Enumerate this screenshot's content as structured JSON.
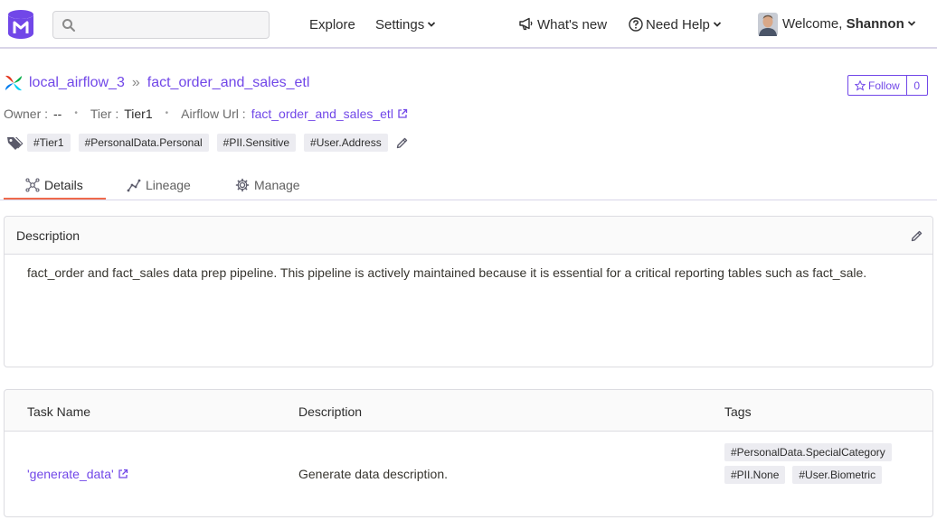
{
  "nav": {
    "search_placeholder": "",
    "explore": "Explore",
    "settings": "Settings",
    "whats_new": "What's new",
    "need_help": "Need Help",
    "welcome_prefix": "Welcome, ",
    "user_name": "Shannon"
  },
  "header": {
    "service": "local_airflow_3",
    "separator": "»",
    "pipeline": "fact_order_and_sales_etl",
    "follow_label": "Follow",
    "follow_count": "0"
  },
  "meta": {
    "owner_label": "Owner :",
    "owner_value": "--",
    "tier_label": "Tier :",
    "tier_value": "Tier1",
    "url_label": "Airflow Url :",
    "url_value": "fact_order_and_sales_etl",
    "dot": "•"
  },
  "tags": [
    "#Tier1",
    "#PersonalData.Personal",
    "#PII.Sensitive",
    "#User.Address"
  ],
  "tabs": [
    {
      "label": "Details",
      "icon": "details-icon"
    },
    {
      "label": "Lineage",
      "icon": "lineage-icon"
    },
    {
      "label": "Manage",
      "icon": "manage-icon"
    }
  ],
  "description": {
    "title": "Description",
    "text": "fact_order and fact_sales data prep pipeline. This pipeline is actively maintained because it is essential for a critical reporting tables such as fact_sale."
  },
  "tasks": {
    "columns": [
      "Task Name",
      "Description",
      "Tags"
    ],
    "rows": [
      {
        "name": "'generate_data'",
        "description": "Generate data description.",
        "tags": [
          "#PersonalData.SpecialCategory",
          "#PII.None",
          "#User.Biometric"
        ]
      }
    ]
  },
  "colors": {
    "accent": "#7147e8",
    "active_tab": "#ef6a4c",
    "tag_bg": "#ececf1"
  }
}
